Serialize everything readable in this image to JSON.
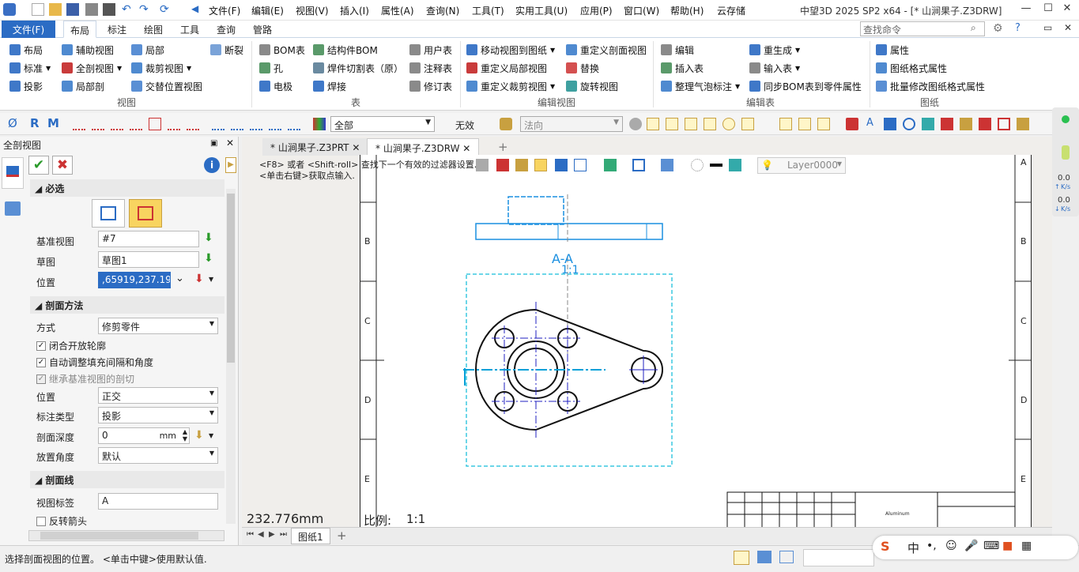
{
  "title_bar": {
    "window_title": "中望3D 2025 SP2 x64 - [* 山涧果子.Z3DRW]",
    "menus": [
      "文件(F)",
      "编辑(E)",
      "视图(V)",
      "插入(I)",
      "属性(A)",
      "查询(N)",
      "工具(T)",
      "实用工具(U)",
      "应用(P)",
      "窗口(W)",
      "帮助(H)",
      "云存储"
    ]
  },
  "ribbon_tabs": [
    "文件(F)",
    "布局",
    "标注",
    "绘图",
    "工具",
    "查询",
    "管路"
  ],
  "search": {
    "placeholder": "查找命令"
  },
  "ribbon": {
    "view_group": {
      "label": "视图",
      "buttons": [
        "布局",
        "辅助视图",
        "局部",
        "断裂",
        "标准",
        "全剖视图",
        "裁剪视图",
        "投影",
        "局部剖",
        "交替位置视图"
      ]
    },
    "table_group": {
      "label": "表",
      "buttons": [
        "BOM表",
        "结构件BOM",
        "用户表",
        "孔",
        "焊件切割表（原）",
        "注释表",
        "电极",
        "焊接",
        "修订表"
      ]
    },
    "edit_view_group": {
      "label": "编辑视图",
      "buttons": [
        "移动视图到图纸",
        "重定义剖面视图",
        "重定义局部视图",
        "替换",
        "重定义裁剪视图",
        "旋转视图"
      ]
    },
    "edit_table_group": {
      "label": "编辑表",
      "buttons": [
        "编辑",
        "重生成",
        "插入表",
        "输入表",
        "整理气泡标注",
        "同步BOM表到零件属性"
      ]
    },
    "drawing_group": {
      "label": "图纸",
      "buttons": [
        "属性",
        "图纸格式属性",
        "批量修改图纸格式属性"
      ]
    }
  },
  "toolbar2": {
    "filter": "全部",
    "status": "无效",
    "direction": "法向"
  },
  "left_panel": {
    "title": "全剖视图",
    "required_section": "必选",
    "base_view_label": "基准视图",
    "base_view_value": "#7",
    "sketch_label": "草图",
    "sketch_value": "草图1",
    "position_label": "位置",
    "position_value": ",65919,237.19595",
    "method_section": "剖面方法",
    "mode_label": "方式",
    "mode_value": "修剪零件",
    "chk1": "闭合开放轮廓",
    "chk2": "自动调整填充间隔和角度",
    "chk3": "继承基准视图的剖切",
    "pos_label": "位置",
    "pos_value": "正交",
    "dim_type_label": "标注类型",
    "dim_type_value": "投影",
    "depth_label": "剖面深度",
    "depth_value": "0",
    "depth_unit": "mm",
    "angle_label": "放置角度",
    "angle_value": "默认",
    "line_section": "剖面线",
    "view_label_label": "视图标签",
    "view_label_value": "A",
    "flip_arrow": "反转箭头"
  },
  "doc_tabs": [
    "* 山涧果子.Z3PRT",
    "* 山涧果子.Z3DRW"
  ],
  "canvas": {
    "hint1": "<F8> 或者 <Shift-roll> 查找下一个有效的过滤器设置.",
    "hint2": "<单击右键>获取点输入.",
    "layer": "Layer0000",
    "coord": "232.776mm",
    "scale_label": "比例:",
    "scale_value": "1:1",
    "section_label": "A-A",
    "section_scale": "1:1",
    "zone_letters": [
      "B",
      "C",
      "D",
      "E"
    ],
    "title_block_text": "Aluminum",
    "sheet_tab": "图纸1"
  },
  "status_bar": {
    "message": "选择剖面视图的位置。 <单击中键>使用默认值."
  },
  "right_meter": {
    "up": "0.0",
    "up_unit": "K/s",
    "down": "0.0",
    "down_unit": "K/s"
  },
  "colors": {
    "accent": "#2b6cc4",
    "drawing_blue": "#1a8fe0",
    "section_line": "#0070c0"
  }
}
